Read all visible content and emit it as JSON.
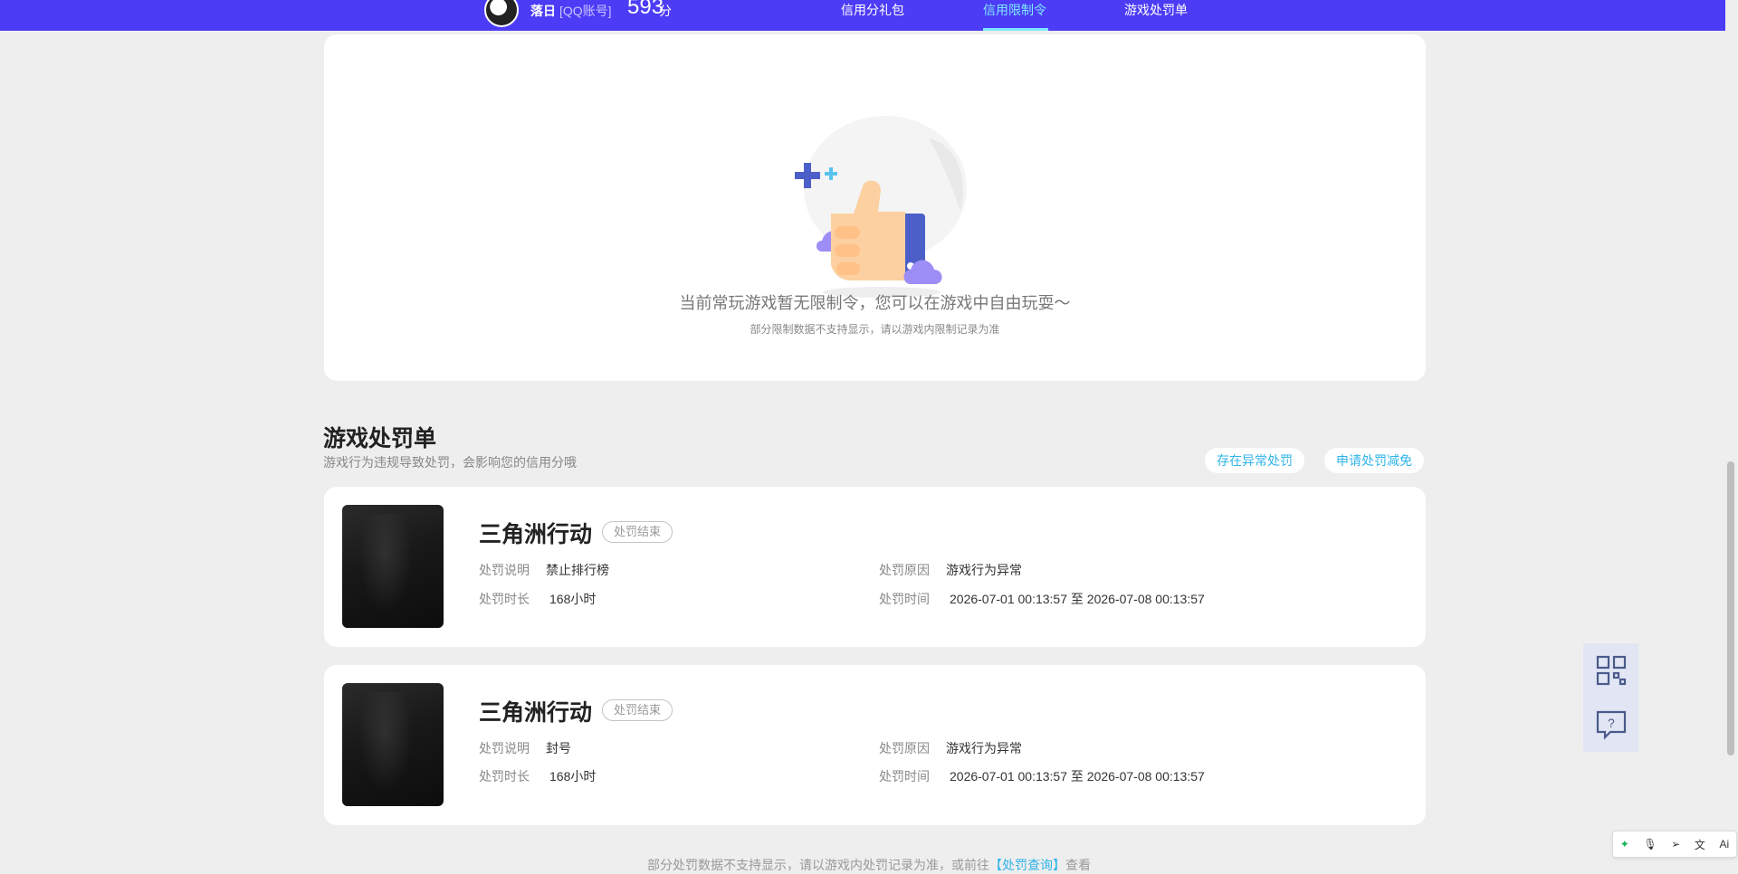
{
  "header": {
    "username": "落日",
    "account_type": "[QQ账号]",
    "score": "593",
    "score_unit": "分",
    "tabs": [
      {
        "label": "信用分礼包",
        "active": false
      },
      {
        "label": "信用限制令",
        "active": true
      },
      {
        "label": "游戏处罚单",
        "active": false
      }
    ]
  },
  "restriction": {
    "empty_text": "当前常玩游戏暂无限制令，您可以在游戏中自由玩耍～",
    "empty_note": "部分限制数据不支持显示，请以游戏内限制记录为准"
  },
  "penalty_section": {
    "title": "游戏处罚单",
    "subtitle": "游戏行为违规导致处罚，会影响您的信用分哦",
    "buttons": [
      "存在异常处罚",
      "申请处罚减免"
    ],
    "labels": {
      "desc": "处罚说明",
      "duration": "处罚时长",
      "reason": "处罚原因",
      "time": "处罚时间",
      "to": "至"
    },
    "items": [
      {
        "game": "三角洲行动",
        "status": "处罚结束",
        "desc": "禁止排行榜",
        "duration": "168小时",
        "reason": "游戏行为异常",
        "start": "2026-07-01 00:13:57",
        "end": "2026-07-08 00:13:57"
      },
      {
        "game": "三角洲行动",
        "status": "处罚结束",
        "desc": "封号",
        "duration": "168小时",
        "reason": "游戏行为异常",
        "start": "2026-07-01 00:13:57",
        "end": "2026-07-08 00:13:57"
      }
    ]
  },
  "footer": {
    "text_before": "部分处罚数据不支持显示，请以游戏内处罚记录为准，或前往",
    "link": "【处罚查询】",
    "text_after": "查看"
  },
  "floating": {
    "icons": [
      "qr-code-icon",
      "help-chat-icon"
    ]
  },
  "toolbar": {
    "icons": [
      "plugin-icon",
      "mic-icon",
      "send-icon",
      "translate-icon",
      "ai-icon"
    ],
    "ai_label": "Ai"
  },
  "colors": {
    "nav_bg": "#4c3cf6",
    "active_tab": "#7fe8ff",
    "link": "#2fb4e8"
  }
}
